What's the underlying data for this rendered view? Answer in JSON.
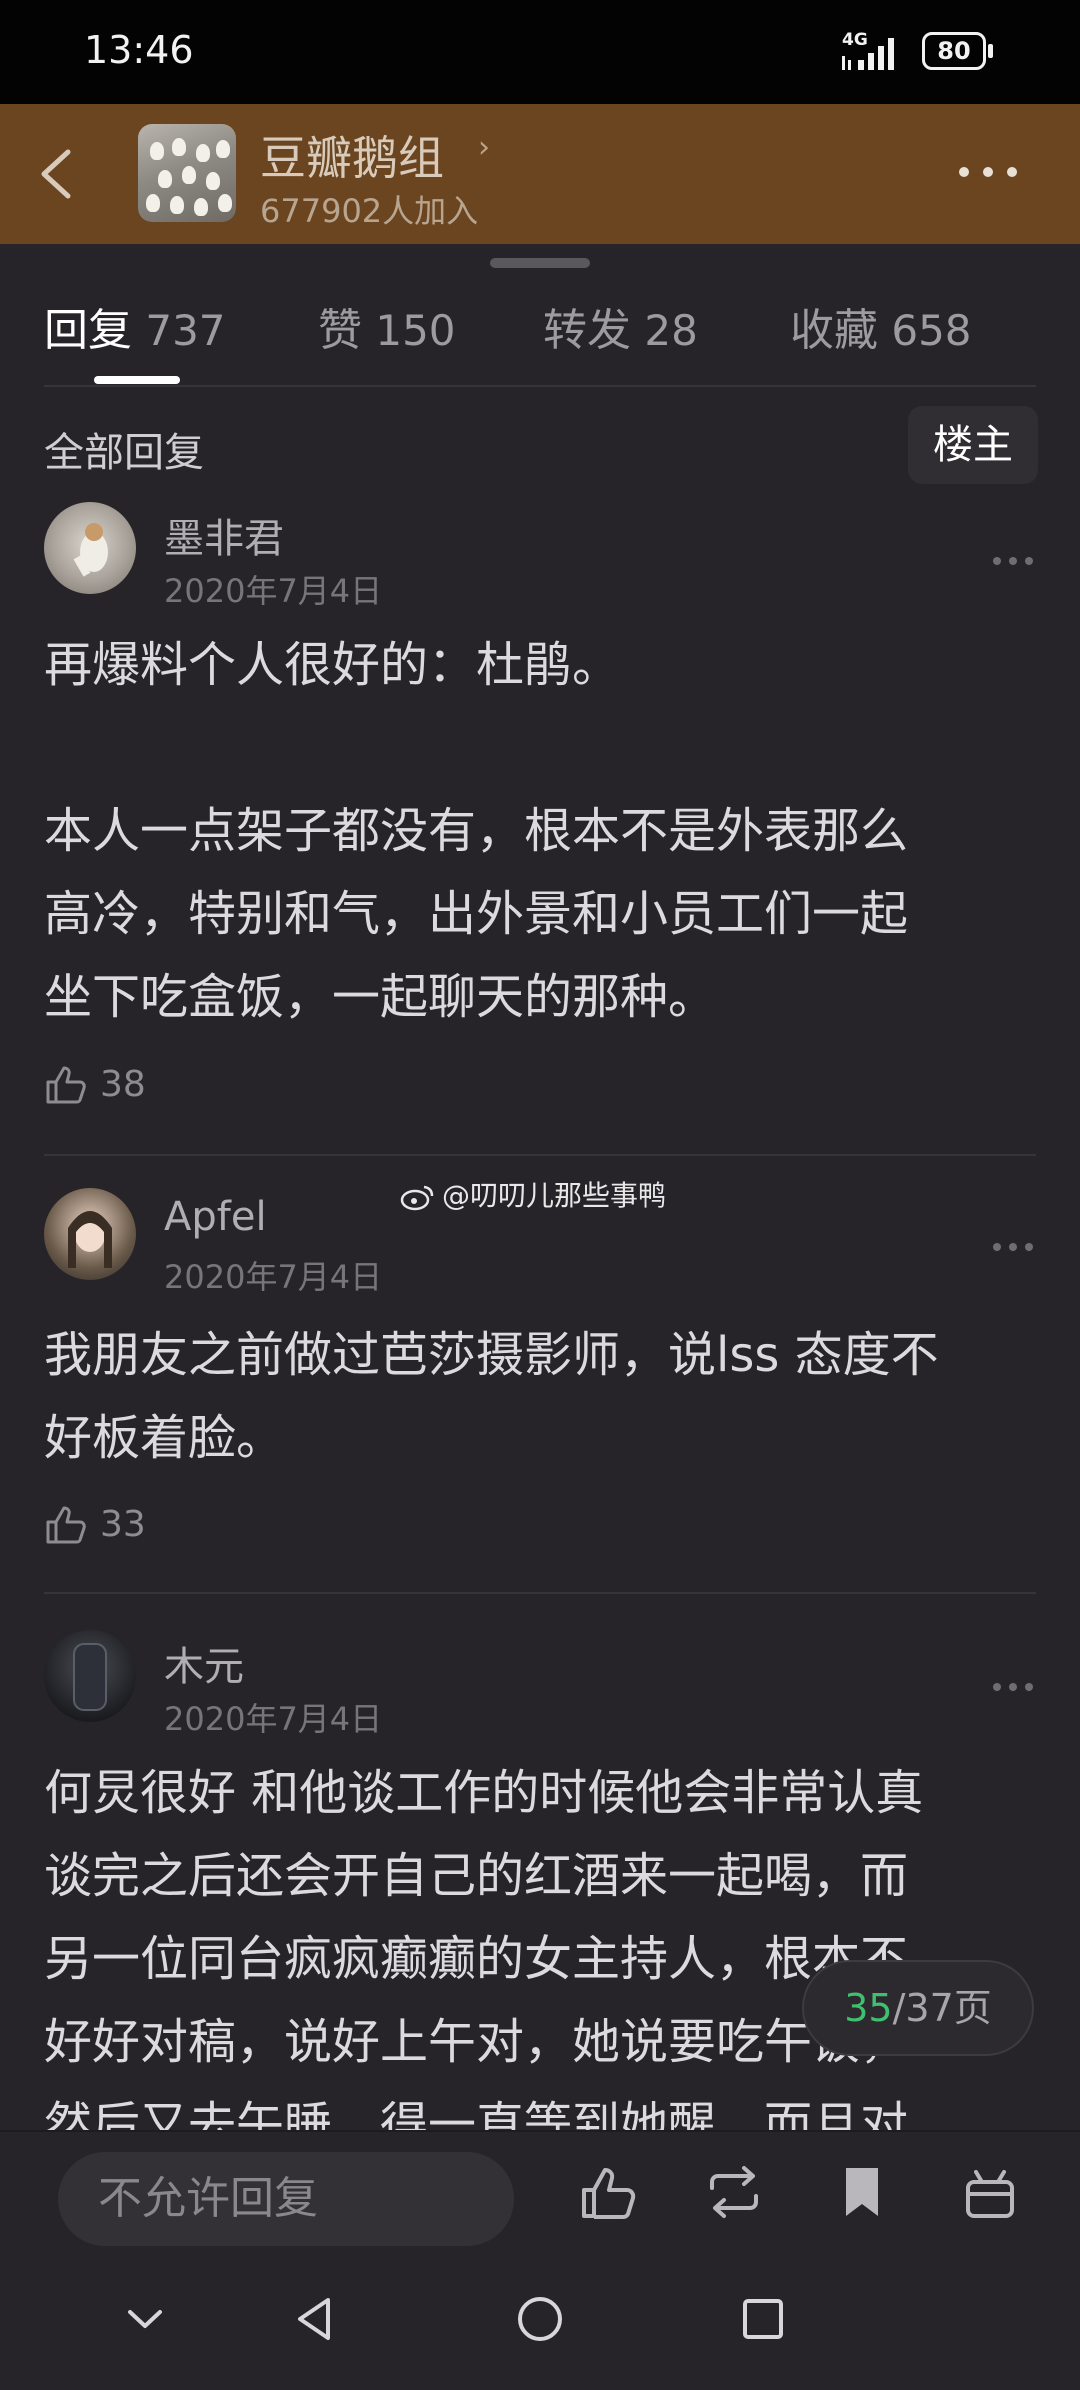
{
  "status_bar": {
    "time": "13:46",
    "network": "4G",
    "battery": "80"
  },
  "group": {
    "name": "豆瓣鹅组",
    "members": "677902人加入"
  },
  "tabs": [
    {
      "label": "回复",
      "count": "737"
    },
    {
      "label": "赞",
      "count": "150"
    },
    {
      "label": "转发",
      "count": "28"
    },
    {
      "label": "收藏",
      "count": "658"
    }
  ],
  "filter": {
    "label": "全部回复",
    "op_only": "楼主"
  },
  "comments": [
    {
      "user": "墨非君",
      "date": "2020年7月4日",
      "body": "再爆料个人很好的：杜鹃。\n\n本人一点架子都没有，根本不是外表那么\n高冷，特别和气，出外景和小员工们一起\n坐下吃盒饭，一起聊天的那种。",
      "likes": "38"
    },
    {
      "user": "Apfel",
      "date": "2020年7月4日",
      "body": "我朋友之前做过芭莎摄影师，说lss 态度不\n好板着脸。",
      "likes": "33"
    },
    {
      "user": "木元",
      "date": "2020年7月4日",
      "body": "何炅很好 和他谈工作的时候他会非常认真\n谈完之后还会开自己的红酒来一起喝，而\n另一位同台疯疯癫癫的女主持人，根本不\n好好对稿，说好上午对，她说要吃午饭，\n然后又去午睡，得一直等到她醒，而且对"
    }
  ],
  "watermark": "@叨叨儿那些事鸭",
  "pagination": {
    "current": "35",
    "total": "/37页"
  },
  "bottom_bar": {
    "reply_placeholder": "不允许回复"
  },
  "colors": {
    "header_bg": "#6b4520",
    "page_bg": "#262428",
    "page_current": "#3fbf6f"
  }
}
